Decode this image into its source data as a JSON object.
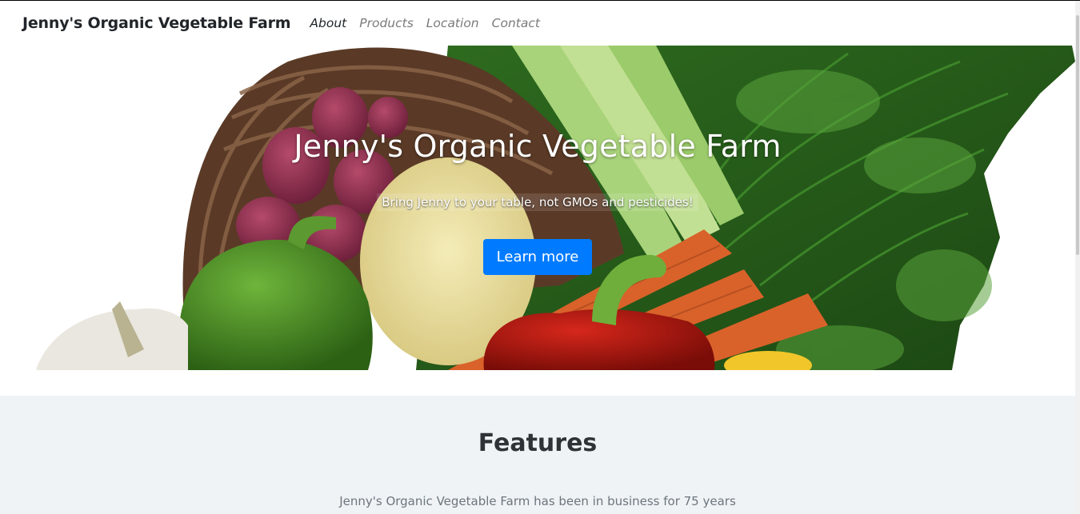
{
  "navbar": {
    "brand": "Jenny's Organic Vegetable Farm",
    "links": [
      {
        "label": "About",
        "active": true
      },
      {
        "label": "Products",
        "active": false
      },
      {
        "label": "Location",
        "active": false
      },
      {
        "label": "Contact",
        "active": false
      }
    ]
  },
  "hero": {
    "title": "Jenny's Organic Vegetable Farm",
    "subtitle": "Bring Jenny to your table, not GMOs and pesticides!",
    "button_label": "Learn more"
  },
  "features": {
    "heading": "Features",
    "text": "Jenny's Organic Vegetable Farm has been in business for 75 years"
  },
  "colors": {
    "primary_button": "#007bff",
    "features_bg": "#f0f3f6",
    "nav_muted": "#7a7a7a"
  }
}
